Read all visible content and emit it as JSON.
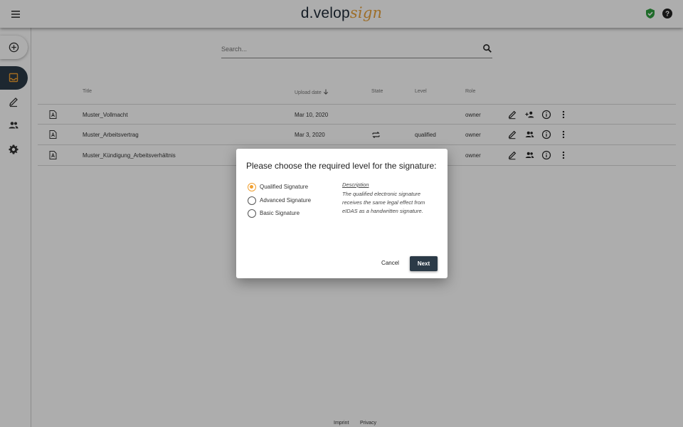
{
  "header": {
    "logo_main": "d.velop",
    "logo_accent": "sign"
  },
  "search": {
    "placeholder": "Search..."
  },
  "table": {
    "headers": {
      "title": "Title",
      "upload_date": "Upload date",
      "state": "State",
      "level": "Level",
      "role": "Role"
    },
    "rows": [
      {
        "title": "Muster_Vollmacht",
        "date": "Mar 10, 2020",
        "state": "",
        "level": "",
        "role": "owner"
      },
      {
        "title": "Muster_Arbeitsvertrag",
        "date": "Mar 3, 2020",
        "state": "sync-icon",
        "level": "qualified",
        "role": "owner"
      },
      {
        "title": "Muster_Kündigung_Arbeitsverhältnis",
        "date": "",
        "state": "",
        "level": "",
        "role": "owner"
      }
    ]
  },
  "footer": {
    "imprint": "Imprint",
    "privacy": "Privacy"
  },
  "dialog": {
    "title": "Please choose the required level for the signature:",
    "options": [
      {
        "label": "Qualified Signature",
        "checked": true
      },
      {
        "label": "Advanced Signature",
        "checked": false
      },
      {
        "label": "Basic Signature",
        "checked": false
      }
    ],
    "description_head": "Description",
    "description_text": "The qualified electronic signature receives the same legal effect from eIDAS as a handwritten signature.",
    "cancel_label": "Cancel",
    "next_label": "Next"
  },
  "colors": {
    "accent": "#f0a030",
    "dark": "#2b3a47",
    "shield": "#2e9e3e"
  }
}
